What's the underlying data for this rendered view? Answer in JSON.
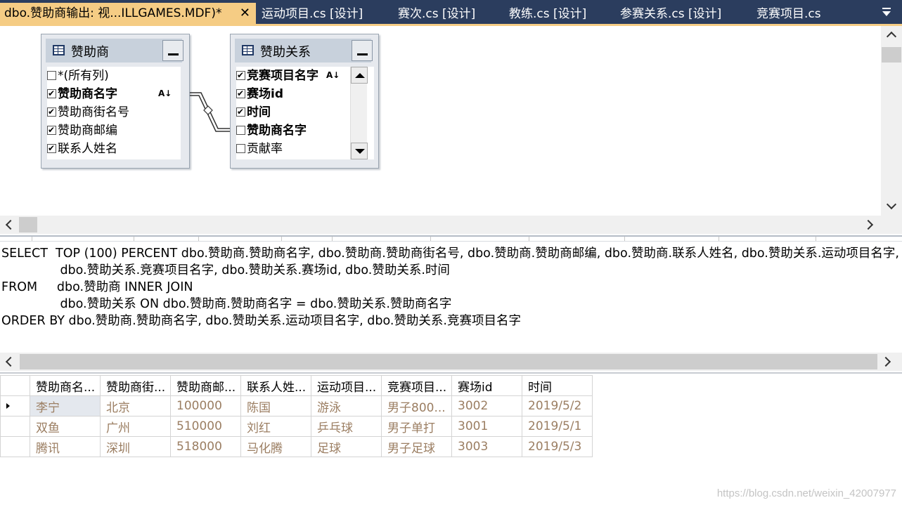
{
  "tabs": [
    {
      "label": "dbo.赞助商输出: 视...ILLGAMES.MDF)*",
      "active": true
    },
    {
      "label": "运动项目.cs [设计]"
    },
    {
      "label": "赛次.cs [设计]"
    },
    {
      "label": "教练.cs [设计]"
    },
    {
      "label": "参赛关系.cs [设计]"
    },
    {
      "label": "竞赛项目.cs"
    }
  ],
  "close_glyph": "✕",
  "diagram": {
    "tables": [
      {
        "title": "赞助商",
        "columns": [
          {
            "label": "*(所有列)",
            "checked": false,
            "bold": false
          },
          {
            "label": "赞助商名字",
            "checked": true,
            "bold": true,
            "sort": "asc"
          },
          {
            "label": "赞助商街名号",
            "checked": true,
            "bold": false
          },
          {
            "label": "赞助商邮编",
            "checked": true,
            "bold": false
          },
          {
            "label": "联系人姓名",
            "checked": true,
            "bold": false
          }
        ]
      },
      {
        "title": "赞助关系",
        "columns": [
          {
            "label": "竞赛项目名字",
            "checked": true,
            "bold": true,
            "sort": "asc"
          },
          {
            "label": "赛场id",
            "checked": true,
            "bold": true
          },
          {
            "label": "时间",
            "checked": true,
            "bold": true
          },
          {
            "label": "赞助商名字",
            "checked": false,
            "bold": true
          },
          {
            "label": "贡献率",
            "checked": false,
            "bold": false
          }
        ]
      }
    ]
  },
  "sql": {
    "lines": [
      "SELECT  TOP (100) PERCENT dbo.赞助商.赞助商名字, dbo.赞助商.赞助商街名号, dbo.赞助商.赞助商邮编, dbo.赞助商.联系人姓名, dbo.赞助关系.运动项目名字,",
      "               dbo.赞助关系.竞赛项目名字, dbo.赞助关系.赛场id, dbo.赞助关系.时间",
      "FROM     dbo.赞助商 INNER JOIN",
      "               dbo.赞助关系 ON dbo.赞助商.赞助商名字 = dbo.赞助关系.赞助商名字",
      "ORDER BY dbo.赞助商.赞助商名字, dbo.赞助关系.运动项目名字, dbo.赞助关系.竞赛项目名字"
    ]
  },
  "results": {
    "columns": [
      "赞助商名...",
      "赞助商街...",
      "赞助商邮...",
      "联系人姓...",
      "运动项目...",
      "竞赛项目...",
      "赛场id",
      "时间"
    ],
    "rows": [
      [
        "李宁",
        "北京",
        "100000",
        "陈国",
        "游泳",
        "男子800...",
        "3002",
        "2019/5/2"
      ],
      [
        "双鱼",
        "广州",
        "510000",
        "刘红",
        "乒乓球",
        "男子单打",
        "3001",
        "2019/5/1"
      ],
      [
        "腾讯",
        "深圳",
        "518000",
        "马化腾",
        "足球",
        "男子足球",
        "3003",
        "2019/5/3"
      ]
    ]
  },
  "watermark": "https://blog.csdn.net/weixin_42007977"
}
